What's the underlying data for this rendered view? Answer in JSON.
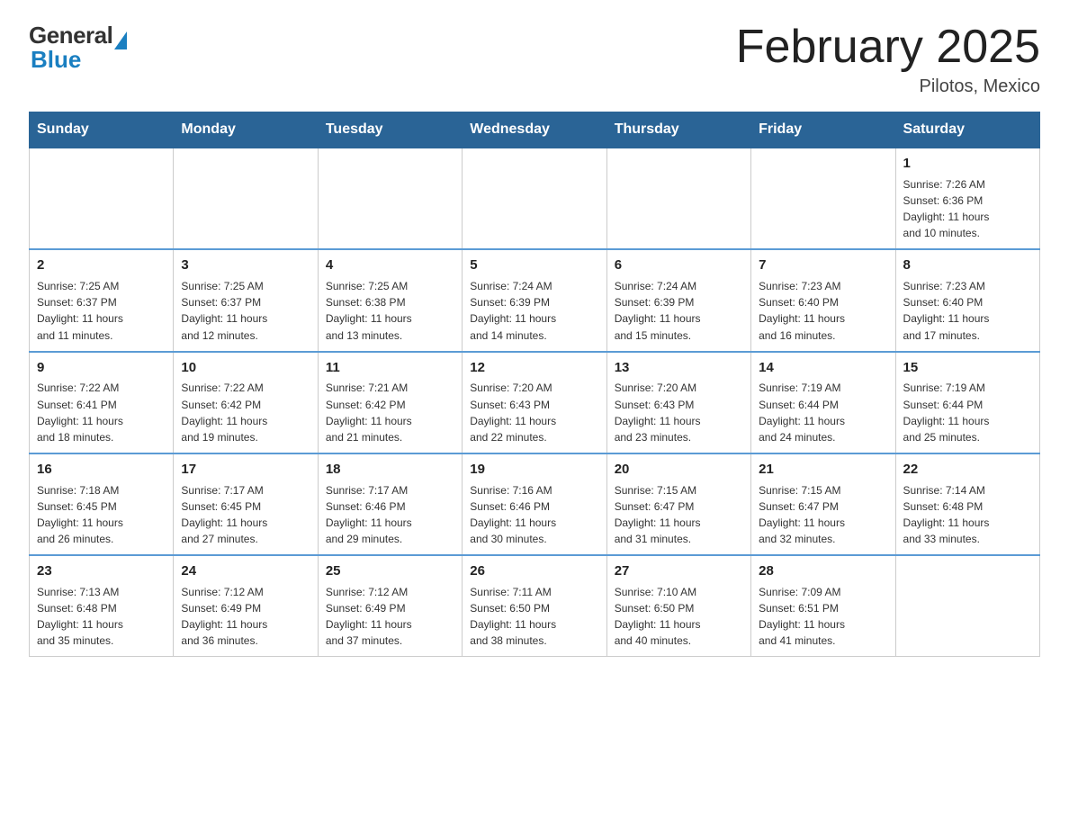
{
  "logo": {
    "general": "General",
    "blue": "Blue"
  },
  "header": {
    "title": "February 2025",
    "subtitle": "Pilotos, Mexico"
  },
  "weekdays": [
    "Sunday",
    "Monday",
    "Tuesday",
    "Wednesday",
    "Thursday",
    "Friday",
    "Saturday"
  ],
  "weeks": [
    [
      {
        "day": "",
        "detail": ""
      },
      {
        "day": "",
        "detail": ""
      },
      {
        "day": "",
        "detail": ""
      },
      {
        "day": "",
        "detail": ""
      },
      {
        "day": "",
        "detail": ""
      },
      {
        "day": "",
        "detail": ""
      },
      {
        "day": "1",
        "detail": "Sunrise: 7:26 AM\nSunset: 6:36 PM\nDaylight: 11 hours\nand 10 minutes."
      }
    ],
    [
      {
        "day": "2",
        "detail": "Sunrise: 7:25 AM\nSunset: 6:37 PM\nDaylight: 11 hours\nand 11 minutes."
      },
      {
        "day": "3",
        "detail": "Sunrise: 7:25 AM\nSunset: 6:37 PM\nDaylight: 11 hours\nand 12 minutes."
      },
      {
        "day": "4",
        "detail": "Sunrise: 7:25 AM\nSunset: 6:38 PM\nDaylight: 11 hours\nand 13 minutes."
      },
      {
        "day": "5",
        "detail": "Sunrise: 7:24 AM\nSunset: 6:39 PM\nDaylight: 11 hours\nand 14 minutes."
      },
      {
        "day": "6",
        "detail": "Sunrise: 7:24 AM\nSunset: 6:39 PM\nDaylight: 11 hours\nand 15 minutes."
      },
      {
        "day": "7",
        "detail": "Sunrise: 7:23 AM\nSunset: 6:40 PM\nDaylight: 11 hours\nand 16 minutes."
      },
      {
        "day": "8",
        "detail": "Sunrise: 7:23 AM\nSunset: 6:40 PM\nDaylight: 11 hours\nand 17 minutes."
      }
    ],
    [
      {
        "day": "9",
        "detail": "Sunrise: 7:22 AM\nSunset: 6:41 PM\nDaylight: 11 hours\nand 18 minutes."
      },
      {
        "day": "10",
        "detail": "Sunrise: 7:22 AM\nSunset: 6:42 PM\nDaylight: 11 hours\nand 19 minutes."
      },
      {
        "day": "11",
        "detail": "Sunrise: 7:21 AM\nSunset: 6:42 PM\nDaylight: 11 hours\nand 21 minutes."
      },
      {
        "day": "12",
        "detail": "Sunrise: 7:20 AM\nSunset: 6:43 PM\nDaylight: 11 hours\nand 22 minutes."
      },
      {
        "day": "13",
        "detail": "Sunrise: 7:20 AM\nSunset: 6:43 PM\nDaylight: 11 hours\nand 23 minutes."
      },
      {
        "day": "14",
        "detail": "Sunrise: 7:19 AM\nSunset: 6:44 PM\nDaylight: 11 hours\nand 24 minutes."
      },
      {
        "day": "15",
        "detail": "Sunrise: 7:19 AM\nSunset: 6:44 PM\nDaylight: 11 hours\nand 25 minutes."
      }
    ],
    [
      {
        "day": "16",
        "detail": "Sunrise: 7:18 AM\nSunset: 6:45 PM\nDaylight: 11 hours\nand 26 minutes."
      },
      {
        "day": "17",
        "detail": "Sunrise: 7:17 AM\nSunset: 6:45 PM\nDaylight: 11 hours\nand 27 minutes."
      },
      {
        "day": "18",
        "detail": "Sunrise: 7:17 AM\nSunset: 6:46 PM\nDaylight: 11 hours\nand 29 minutes."
      },
      {
        "day": "19",
        "detail": "Sunrise: 7:16 AM\nSunset: 6:46 PM\nDaylight: 11 hours\nand 30 minutes."
      },
      {
        "day": "20",
        "detail": "Sunrise: 7:15 AM\nSunset: 6:47 PM\nDaylight: 11 hours\nand 31 minutes."
      },
      {
        "day": "21",
        "detail": "Sunrise: 7:15 AM\nSunset: 6:47 PM\nDaylight: 11 hours\nand 32 minutes."
      },
      {
        "day": "22",
        "detail": "Sunrise: 7:14 AM\nSunset: 6:48 PM\nDaylight: 11 hours\nand 33 minutes."
      }
    ],
    [
      {
        "day": "23",
        "detail": "Sunrise: 7:13 AM\nSunset: 6:48 PM\nDaylight: 11 hours\nand 35 minutes."
      },
      {
        "day": "24",
        "detail": "Sunrise: 7:12 AM\nSunset: 6:49 PM\nDaylight: 11 hours\nand 36 minutes."
      },
      {
        "day": "25",
        "detail": "Sunrise: 7:12 AM\nSunset: 6:49 PM\nDaylight: 11 hours\nand 37 minutes."
      },
      {
        "day": "26",
        "detail": "Sunrise: 7:11 AM\nSunset: 6:50 PM\nDaylight: 11 hours\nand 38 minutes."
      },
      {
        "day": "27",
        "detail": "Sunrise: 7:10 AM\nSunset: 6:50 PM\nDaylight: 11 hours\nand 40 minutes."
      },
      {
        "day": "28",
        "detail": "Sunrise: 7:09 AM\nSunset: 6:51 PM\nDaylight: 11 hours\nand 41 minutes."
      },
      {
        "day": "",
        "detail": ""
      }
    ]
  ]
}
